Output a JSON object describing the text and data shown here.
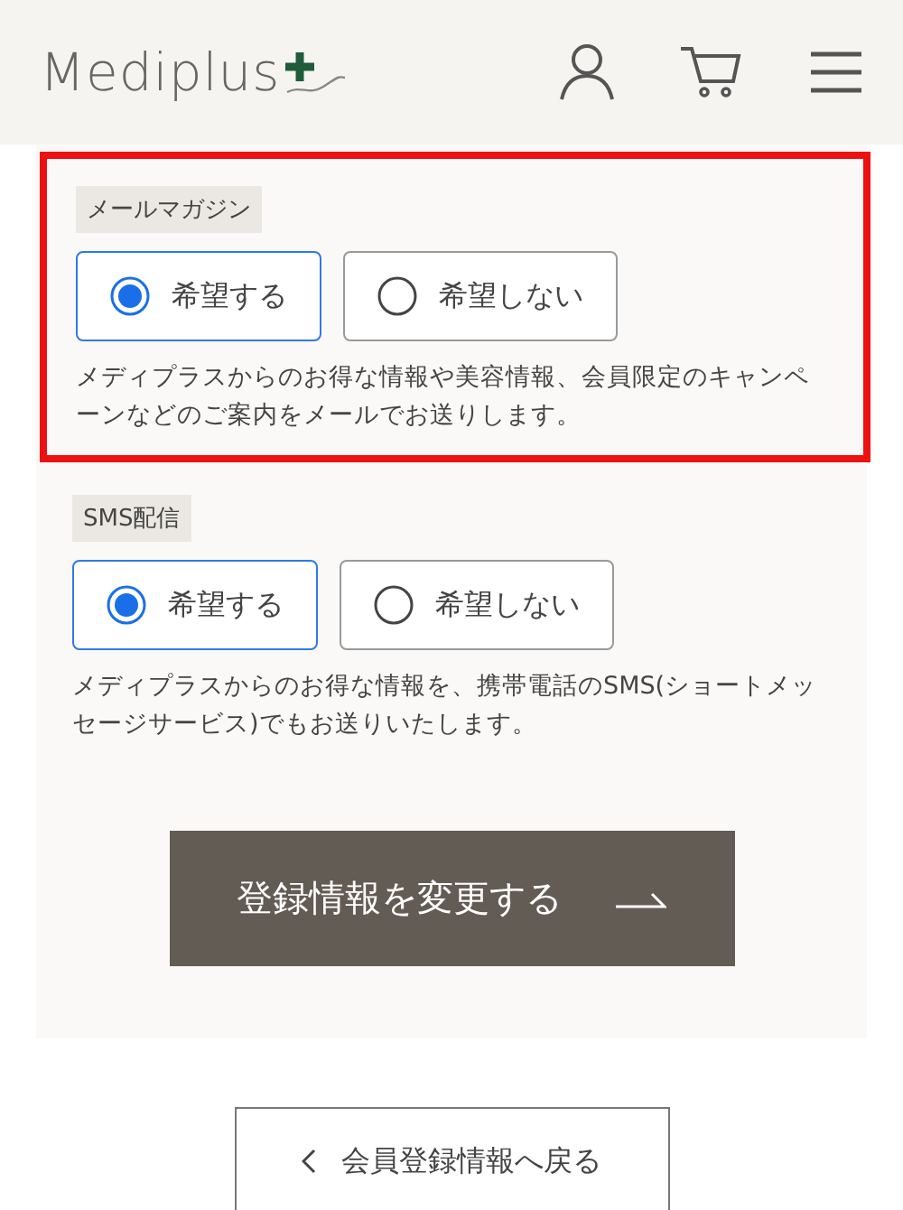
{
  "header": {
    "logo": "Mediplus"
  },
  "sections": [
    {
      "label": "メールマガジン",
      "highlighted": true,
      "options": [
        {
          "label": "希望する",
          "selected": true
        },
        {
          "label": "希望しない",
          "selected": false
        }
      ],
      "description": "メディプラスからのお得な情報や美容情報、会員限定のキャンペーンなどのご案内をメールでお送りします。"
    },
    {
      "label": "SMS配信",
      "highlighted": false,
      "options": [
        {
          "label": "希望する",
          "selected": true
        },
        {
          "label": "希望しない",
          "selected": false
        }
      ],
      "description": "メディプラスからのお得な情報を、携帯電話のSMS(ショートメッセージサービス)でもお送りいたします。"
    }
  ],
  "submit_button": "登録情報を変更する",
  "back_button": "会員登録情報へ戻る"
}
